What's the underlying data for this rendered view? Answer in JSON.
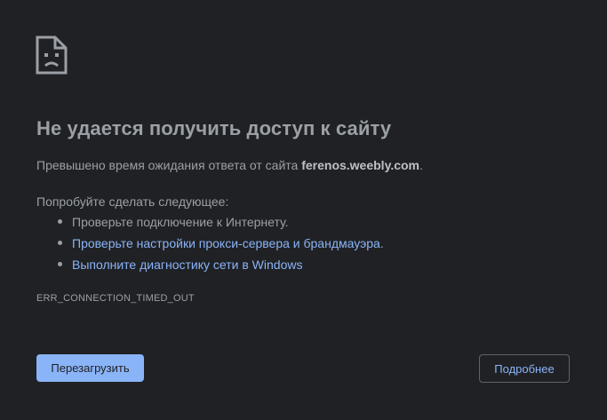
{
  "error_icon": "sad-page-icon",
  "title": "Не удается получить доступ к сайту",
  "timeout": {
    "prefix": "Превышено время ожидания ответа от сайта ",
    "host": "ferenos.weebly.com",
    "suffix": "."
  },
  "try_heading": "Попробуйте сделать следующее:",
  "suggestions": [
    {
      "text": "Проверьте подключение к Интернету.",
      "is_link": false
    },
    {
      "text": "Проверьте настройки прокси-сервера и брандмауэра",
      "trailing": ".",
      "is_link": true
    },
    {
      "text": "Выполните диагностику сети в Windows",
      "is_link": true
    }
  ],
  "error_code": "ERR_CONNECTION_TIMED_OUT",
  "buttons": {
    "reload": "Перезагрузить",
    "details": "Подробнее"
  },
  "colors": {
    "background": "#202124",
    "text": "#9aa0a6",
    "accent": "#8ab4f8"
  }
}
